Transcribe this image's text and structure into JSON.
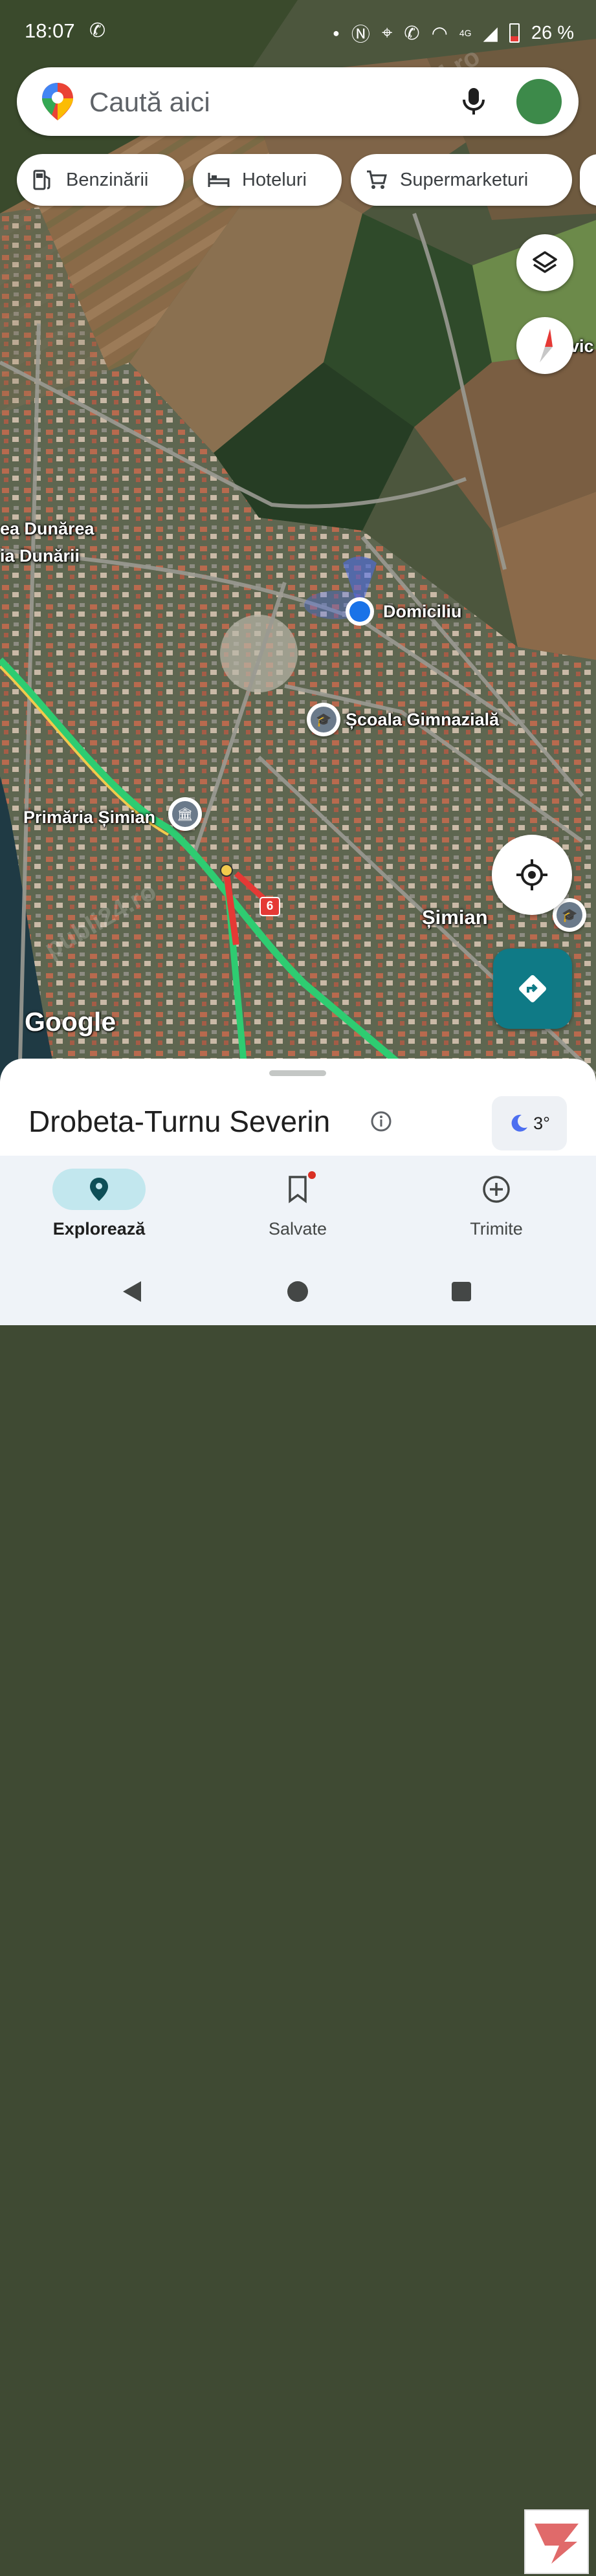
{
  "status_bar": {
    "time": "18:07",
    "battery": "26 %",
    "network": "4G"
  },
  "search": {
    "placeholder": "Caută aici"
  },
  "chips": [
    {
      "label": "Benzinării",
      "icon": "gas-station-icon"
    },
    {
      "label": "Hoteluri",
      "icon": "bed-icon"
    },
    {
      "label": "Supermarketuri",
      "icon": "shopping-cart-icon"
    }
  ],
  "map": {
    "labels": {
      "place_left_1": "ea Dunărea",
      "place_left_2": "ia Dunării",
      "home": "Domiciliu",
      "school": "Școala Gimnazială",
      "town_hall": "Primăria Șimian",
      "town": "Șimian",
      "edge_right": "vic",
      "road_number": "6"
    },
    "logo": "Google"
  },
  "sheet": {
    "city": "Drobeta-Turnu Severin",
    "temperature": "3°"
  },
  "nav": {
    "items": [
      {
        "label": "Explorează",
        "icon": "location-pin-icon",
        "active": true
      },
      {
        "label": "Salvate",
        "icon": "bookmark-icon",
        "active": false
      },
      {
        "label": "Trimite",
        "icon": "add-circle-icon",
        "active": false
      }
    ]
  },
  "watermark": "publi24.ro",
  "colors": {
    "accent_teal": "#0f7a86",
    "traffic_green": "#2ecc71",
    "traffic_red": "#e53935",
    "location_blue": "#1a73e8",
    "nav_active": "#c2e7ee"
  }
}
